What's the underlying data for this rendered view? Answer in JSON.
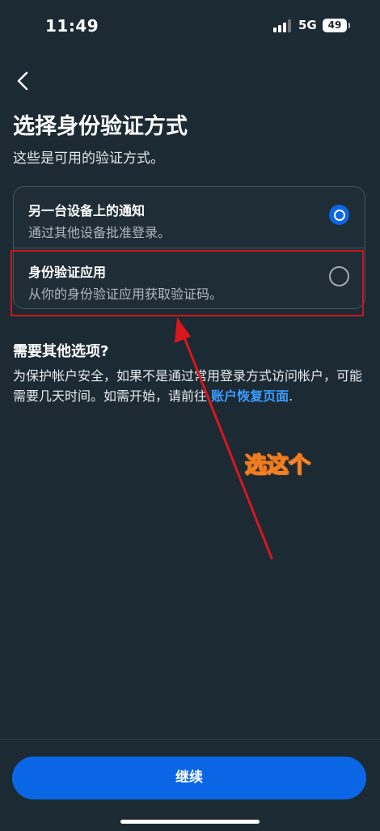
{
  "status_bar": {
    "time": "11:49",
    "network": "5G",
    "battery": "49"
  },
  "header": {
    "title": "选择身份验证方式",
    "subtitle": "这些是可用的验证方式。"
  },
  "options": [
    {
      "title": "另一台设备上的通知",
      "description": "通过其他设备批准登录。",
      "selected": true
    },
    {
      "title": "身份验证应用",
      "description": "从你的身份验证应用获取验证码。",
      "selected": false
    }
  ],
  "help": {
    "heading": "需要其他选项?",
    "text": "为保护帐户安全，如果不是通过常用登录方式访问帐户，可能需要几天时间。如需开始，请前往 ",
    "link": "账户恢复页面",
    "text_end": "."
  },
  "annotation": {
    "label": "选这个",
    "color": "#d9161c"
  },
  "footer": {
    "continue_label": "继续"
  },
  "colors": {
    "background": "#1c2a33",
    "accent": "#0a66e4",
    "link": "#3b9cff"
  }
}
